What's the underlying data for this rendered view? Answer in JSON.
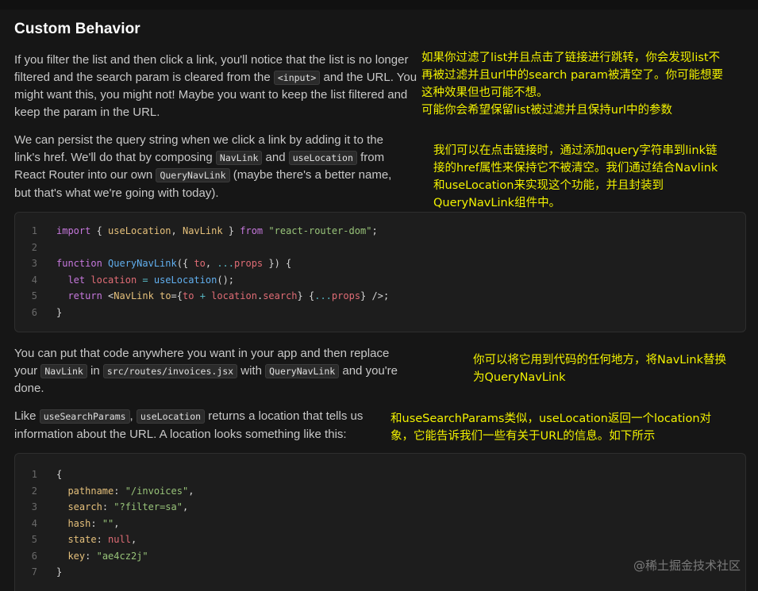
{
  "heading": "Custom Behavior",
  "p1": {
    "t1": "If you filter the list and then click a link, you'll notice that the list is no longer filtered and the search param is cleared from the ",
    "c1": "<input>",
    "t2": " and the URL. You might want this, you might not! Maybe you want to keep the list filtered and keep the param in the URL."
  },
  "note1": {
    "l1": "如果你过滤了list并且点击了链接进行跳转，你会发现list不",
    "l2": "再被过滤并且url中的search param被清空了。你可能想要",
    "l3": "这种效果但也可能不想。",
    "l4": "可能你会希望保留list被过滤并且保持url中的参数"
  },
  "p2": {
    "t1": "We can persist the query string when we click a link by adding it to the link's href. We'll do that by composing ",
    "c1": "NavLink",
    "t2": " and ",
    "c2": "useLocation",
    "t3": " from React Router into our own ",
    "c3": "QueryNavLink",
    "t4": " (maybe there's a better name, but that's what we're going with today)."
  },
  "note2": {
    "l1": "我们可以在点击链接时，通过添加query字符串到link链",
    "l2": "接的href属性来保持它不被清空。我们通过结合Navlink",
    "l3": "和useLocation来实现这个功能，并且封装到",
    "l4": "QueryNavLink组件中。"
  },
  "code1": {
    "n1": "1",
    "n2": "2",
    "n3": "3",
    "n4": "4",
    "n5": "5",
    "n6": "6",
    "import": "import",
    "brace_open": " { ",
    "useLocation": "useLocation",
    "comma": ", ",
    "NavLink": "NavLink",
    "brace_close": " } ",
    "from": "from",
    "module": "\"react-router-dom\"",
    "semi": ";",
    "function": "function",
    "fname": "QueryNavLink",
    "args_open": "({ ",
    "to": "to",
    "spread": "...",
    "props": "props",
    "args_close": " }) {",
    "let": "let",
    "location": "location",
    "eq": " = ",
    "call": "();",
    "return": "return",
    "lt": "<",
    "tagname": "NavLink",
    "to_attr": "to",
    "eq2": "=",
    "expr_open": "{",
    "plus": " + ",
    "location_search_obj": "location",
    "dot": ".",
    "search": "search",
    "expr_close": "}",
    "spread_open": " {",
    "spread_close": "}",
    "self_close": " />;",
    "close": "}"
  },
  "p3": {
    "t1": "You can put that code anywhere you want in your app and then replace your ",
    "c1": "NavLink",
    "t2": " in ",
    "c2": "src/routes/invoices.jsx",
    "t3": " with ",
    "c3": "QueryNavLink",
    "t4": " and you're done."
  },
  "note3": {
    "l1": "你可以将它用到代码的任何地方，将NavLink替换",
    "l2": "为QueryNavLink"
  },
  "p4": {
    "t1": "Like ",
    "c1": "useSearchParams",
    "t2": ", ",
    "c2": "useLocation",
    "t3": " returns a location that tells us information about the URL. A location looks something like this:"
  },
  "note4": {
    "l1": "和useSearchParams类似，useLocation返回一个location对",
    "l2": "象，它能告诉我们一些有关于URL的信息。如下所示"
  },
  "code2": {
    "n1": "1",
    "n2": "2",
    "n3": "3",
    "n4": "4",
    "n5": "5",
    "n6": "6",
    "n7": "7",
    "open": "{",
    "pathname": "pathname",
    "pathname_val": "\"/invoices\"",
    "search": "search",
    "search_val": "\"?filter=sa\"",
    "hash": "hash",
    "hash_val": "\"\"",
    "state": "state",
    "state_val": "null",
    "key": "key",
    "key_val": "\"ae4cz2j\"",
    "colon": ": ",
    "comma": ",",
    "close": "}"
  },
  "watermark": "@稀土掘金技术社区"
}
